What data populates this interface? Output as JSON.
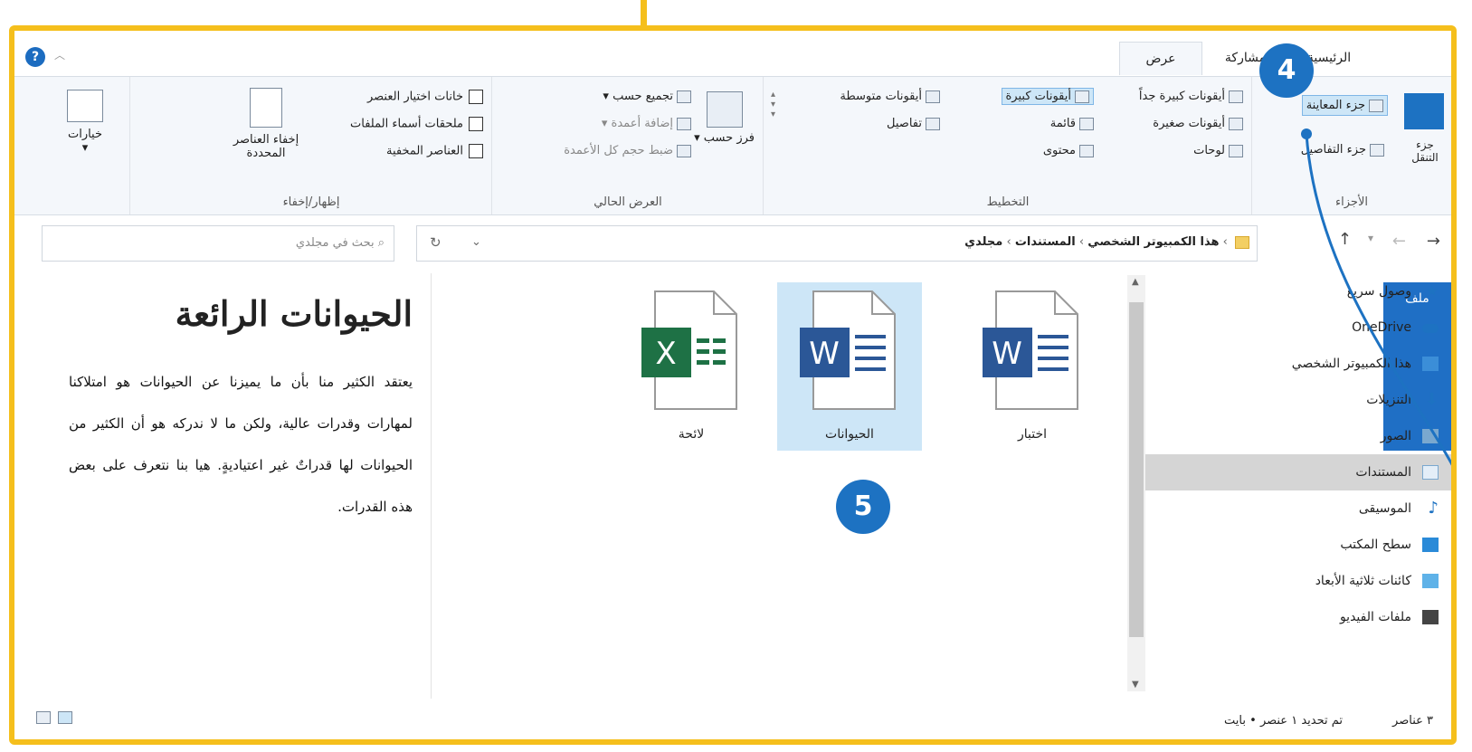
{
  "tabs": {
    "file": "ملف",
    "home": "الرئيسية",
    "share": "مشاركة",
    "view": "عرض"
  },
  "ribbon": {
    "panes": {
      "nav_pane": "جزء التنقل",
      "preview_pane": "جزء المعاينة",
      "details_pane": "جزء التفاصيل",
      "group": "الأجزاء"
    },
    "layout": {
      "xlarge": "أيقونات كبيرة جداً",
      "large": "أيقونات كبيرة",
      "medium": "أيقونات متوسطة",
      "small": "أيقونات صغيرة",
      "list": "قائمة",
      "details": "تفاصيل",
      "tiles": "لوحات",
      "content": "محتوى",
      "group": "التخطيط"
    },
    "current_view": {
      "sort": "فرز حسب",
      "group_by": "تجميع حسب",
      "add_columns": "إضافة أعمدة",
      "fit_columns": "ضبط حجم كل الأعمدة",
      "group": "العرض الحالي"
    },
    "show_hide": {
      "checkboxes": "خانات اختيار العنصر",
      "extensions": "ملحقات أسماء الملفات",
      "hidden": "العناصر المخفية",
      "hide_selected": "إخفاء العناصر المحددة",
      "group": "إظهار/إخفاء"
    },
    "options": "خيارات"
  },
  "address": {
    "path": [
      "هذا الكمبيوتر الشخصي",
      "المستندات",
      "مجلدي"
    ],
    "search_placeholder": "بحث في مجلدي"
  },
  "nav": [
    {
      "label": "وصول سريع",
      "icon": "star-icon"
    },
    {
      "label": "OneDrive",
      "icon": "cloud-icon"
    },
    {
      "label": "هذا الكمبيوتر الشخصي",
      "icon": "computer-icon"
    },
    {
      "label": "التنزيلات",
      "icon": "download-icon"
    },
    {
      "label": "الصور",
      "icon": "pictures-icon"
    },
    {
      "label": "المستندات",
      "icon": "documents-icon"
    },
    {
      "label": "الموسيقى",
      "icon": "music-icon"
    },
    {
      "label": "سطح المكتب",
      "icon": "desktop-icon"
    },
    {
      "label": "كائنات ثلاثية الأبعاد",
      "icon": "3d-objects-icon"
    },
    {
      "label": "ملفات الفيديو",
      "icon": "video-icon"
    }
  ],
  "files": [
    {
      "name": "اختبار",
      "type": "word"
    },
    {
      "name": "الحيوانات",
      "type": "word"
    },
    {
      "name": "لائحة",
      "type": "excel"
    }
  ],
  "preview": {
    "title": "الحيوانات الرائعة",
    "body": "يعتقد الكثير منا بأن ما يميزنا عن الحيوانات هو امتلاكنا لمهارات وقدرات عالية، ولكن ما لا ندركه هو أن الكثير من الحيوانات لها قدراتٌ غير اعتياديةٍ. هيا بنا نتعرف على بعض هذه القدرات."
  },
  "status": {
    "count": "٣ عناصر",
    "selected": "تم تحديد ١ عنصر • بايت"
  },
  "callouts": {
    "four": "4",
    "five": "5"
  },
  "colors": {
    "accent": "#1d72c2",
    "frame": "#f5bf1c",
    "selection": "#cde6f7"
  }
}
